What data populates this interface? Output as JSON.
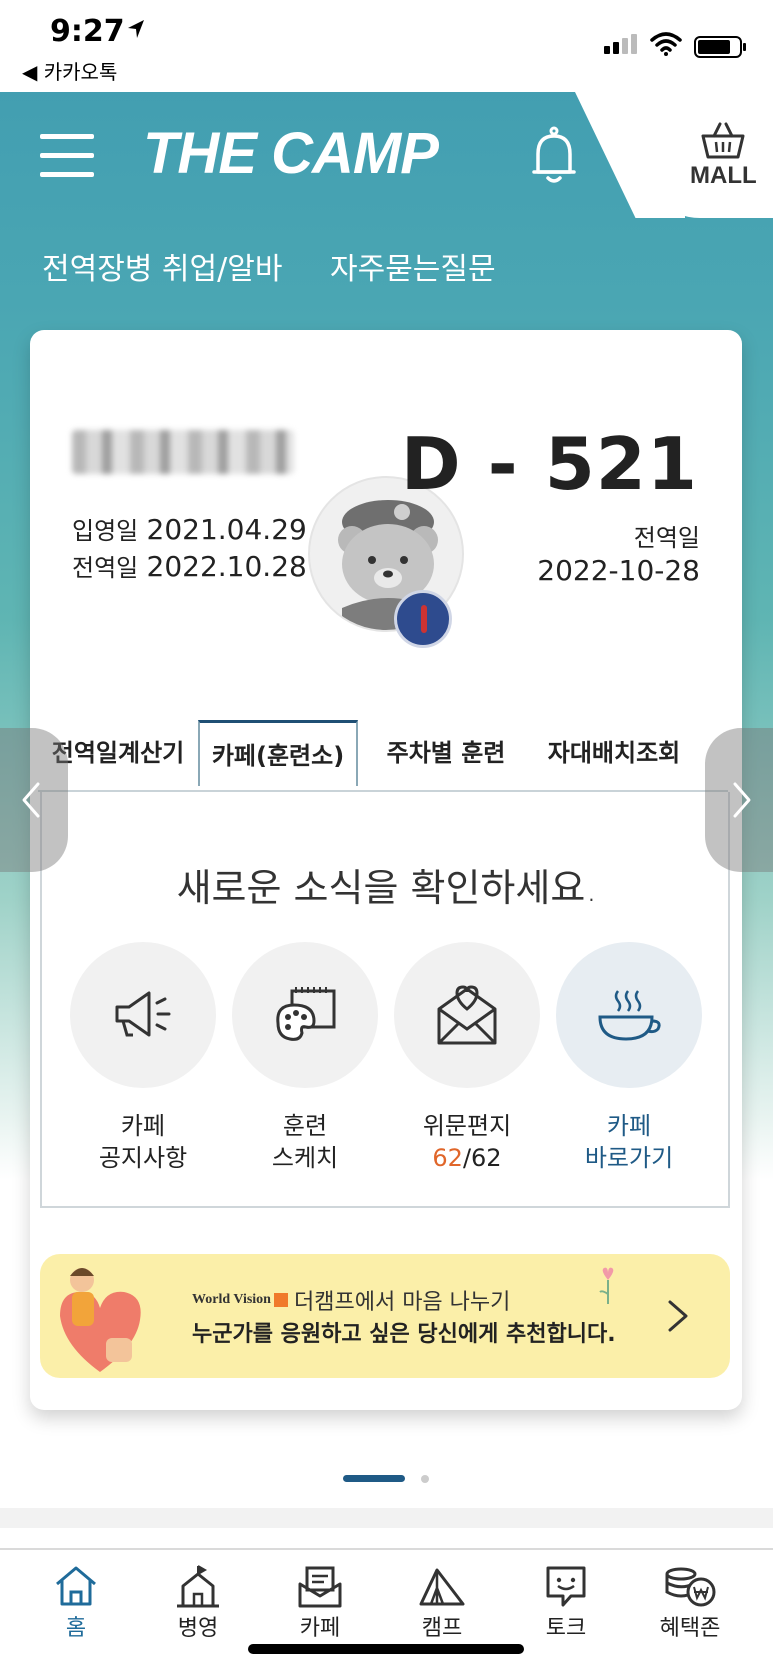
{
  "status_bar": {
    "time": "9:27",
    "back_app": "◀ 카카오톡"
  },
  "header": {
    "logo": "THE CAMP",
    "mall_label": "MALL",
    "subnav": [
      "전역장병 취업/알바",
      "자주묻는질문"
    ]
  },
  "profile": {
    "enlist_label": "입영일",
    "enlist_date": "2021.04.29",
    "discharge_label": "전역일",
    "discharge_date": "2022.10.28",
    "dday": "D - 521",
    "discharge_label_right": "전역일",
    "discharge_date_right": "2022-10-28"
  },
  "tabs": [
    "전역일계산기",
    "카페(훈련소)",
    "주차별 훈련",
    "자대배치조회"
  ],
  "panel": {
    "headline": "새로운 소식을 확인하세요.",
    "items": [
      {
        "line1": "카페",
        "line2": "공지사항"
      },
      {
        "line1": "훈련",
        "line2": "스케치"
      },
      {
        "line1": "위문편지",
        "count": "62",
        "total": "/62"
      },
      {
        "line1": "카페",
        "line2": "바로가기"
      }
    ]
  },
  "banner": {
    "org": "World Vision",
    "title": "더캠프에서 마음 나누기",
    "subtitle": "누군가를 응원하고 싶은 당신에게 추천합니다."
  },
  "bottom_nav": [
    "홈",
    "병영",
    "카페",
    "캠프",
    "토크",
    "혜택존"
  ],
  "colors": {
    "header_teal": "#3f9bb0",
    "accent_blue": "#1f5a86",
    "count_orange": "#e0662a",
    "banner_yellow": "#fbefa9"
  }
}
